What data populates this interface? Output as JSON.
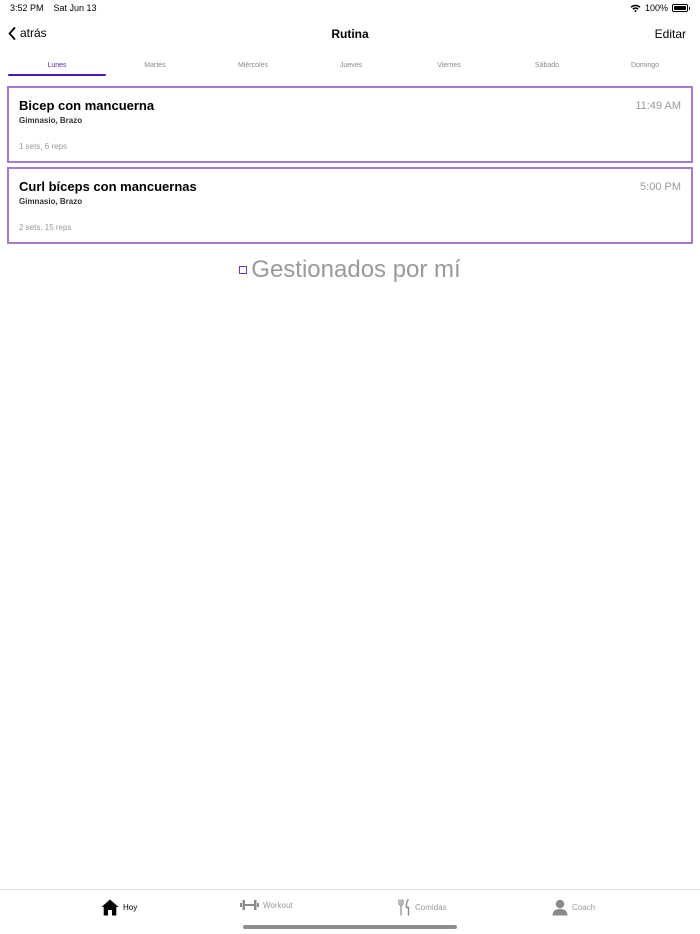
{
  "status": {
    "time": "3:52 PM",
    "date": "Sat Jun 13",
    "battery": "100%",
    "icons": [
      "wifi-icon",
      "battery-icon"
    ]
  },
  "nav": {
    "back_label": "atrás",
    "title": "Rutina",
    "edit_label": "Editar"
  },
  "days": {
    "items": [
      "Lunes",
      "Martes",
      "Miércoles",
      "Jueves",
      "Viernes",
      "Sábado",
      "Domingo"
    ],
    "selected": "Lunes"
  },
  "routines": [
    {
      "title": "Bicep con mancuerna",
      "subtitle": "Gimnasio, Brazo",
      "time": "11:49 AM",
      "sets": "1 sets, 6 reps"
    },
    {
      "title": "Curl bíceps con mancuernas",
      "subtitle": "Gimnasio, Brazo",
      "time": "5:00 PM",
      "sets": "2 sets, 15 reps"
    }
  ],
  "managed": {
    "label": "Gestionados por mí",
    "checked": false
  },
  "tabbar": {
    "items": [
      {
        "label": "Hoy",
        "icon": "home-icon",
        "active": true
      },
      {
        "label": "Workout",
        "icon": "dumbbell-icon",
        "active": false
      },
      {
        "label": "Comidas",
        "icon": "fork-knife-icon",
        "active": false
      },
      {
        "label": "Coach",
        "icon": "person-icon",
        "active": false
      }
    ]
  },
  "colors": {
    "accent": "#4b16bb",
    "card_border": "#a67acb",
    "muted_text": "#9a9a9a"
  }
}
